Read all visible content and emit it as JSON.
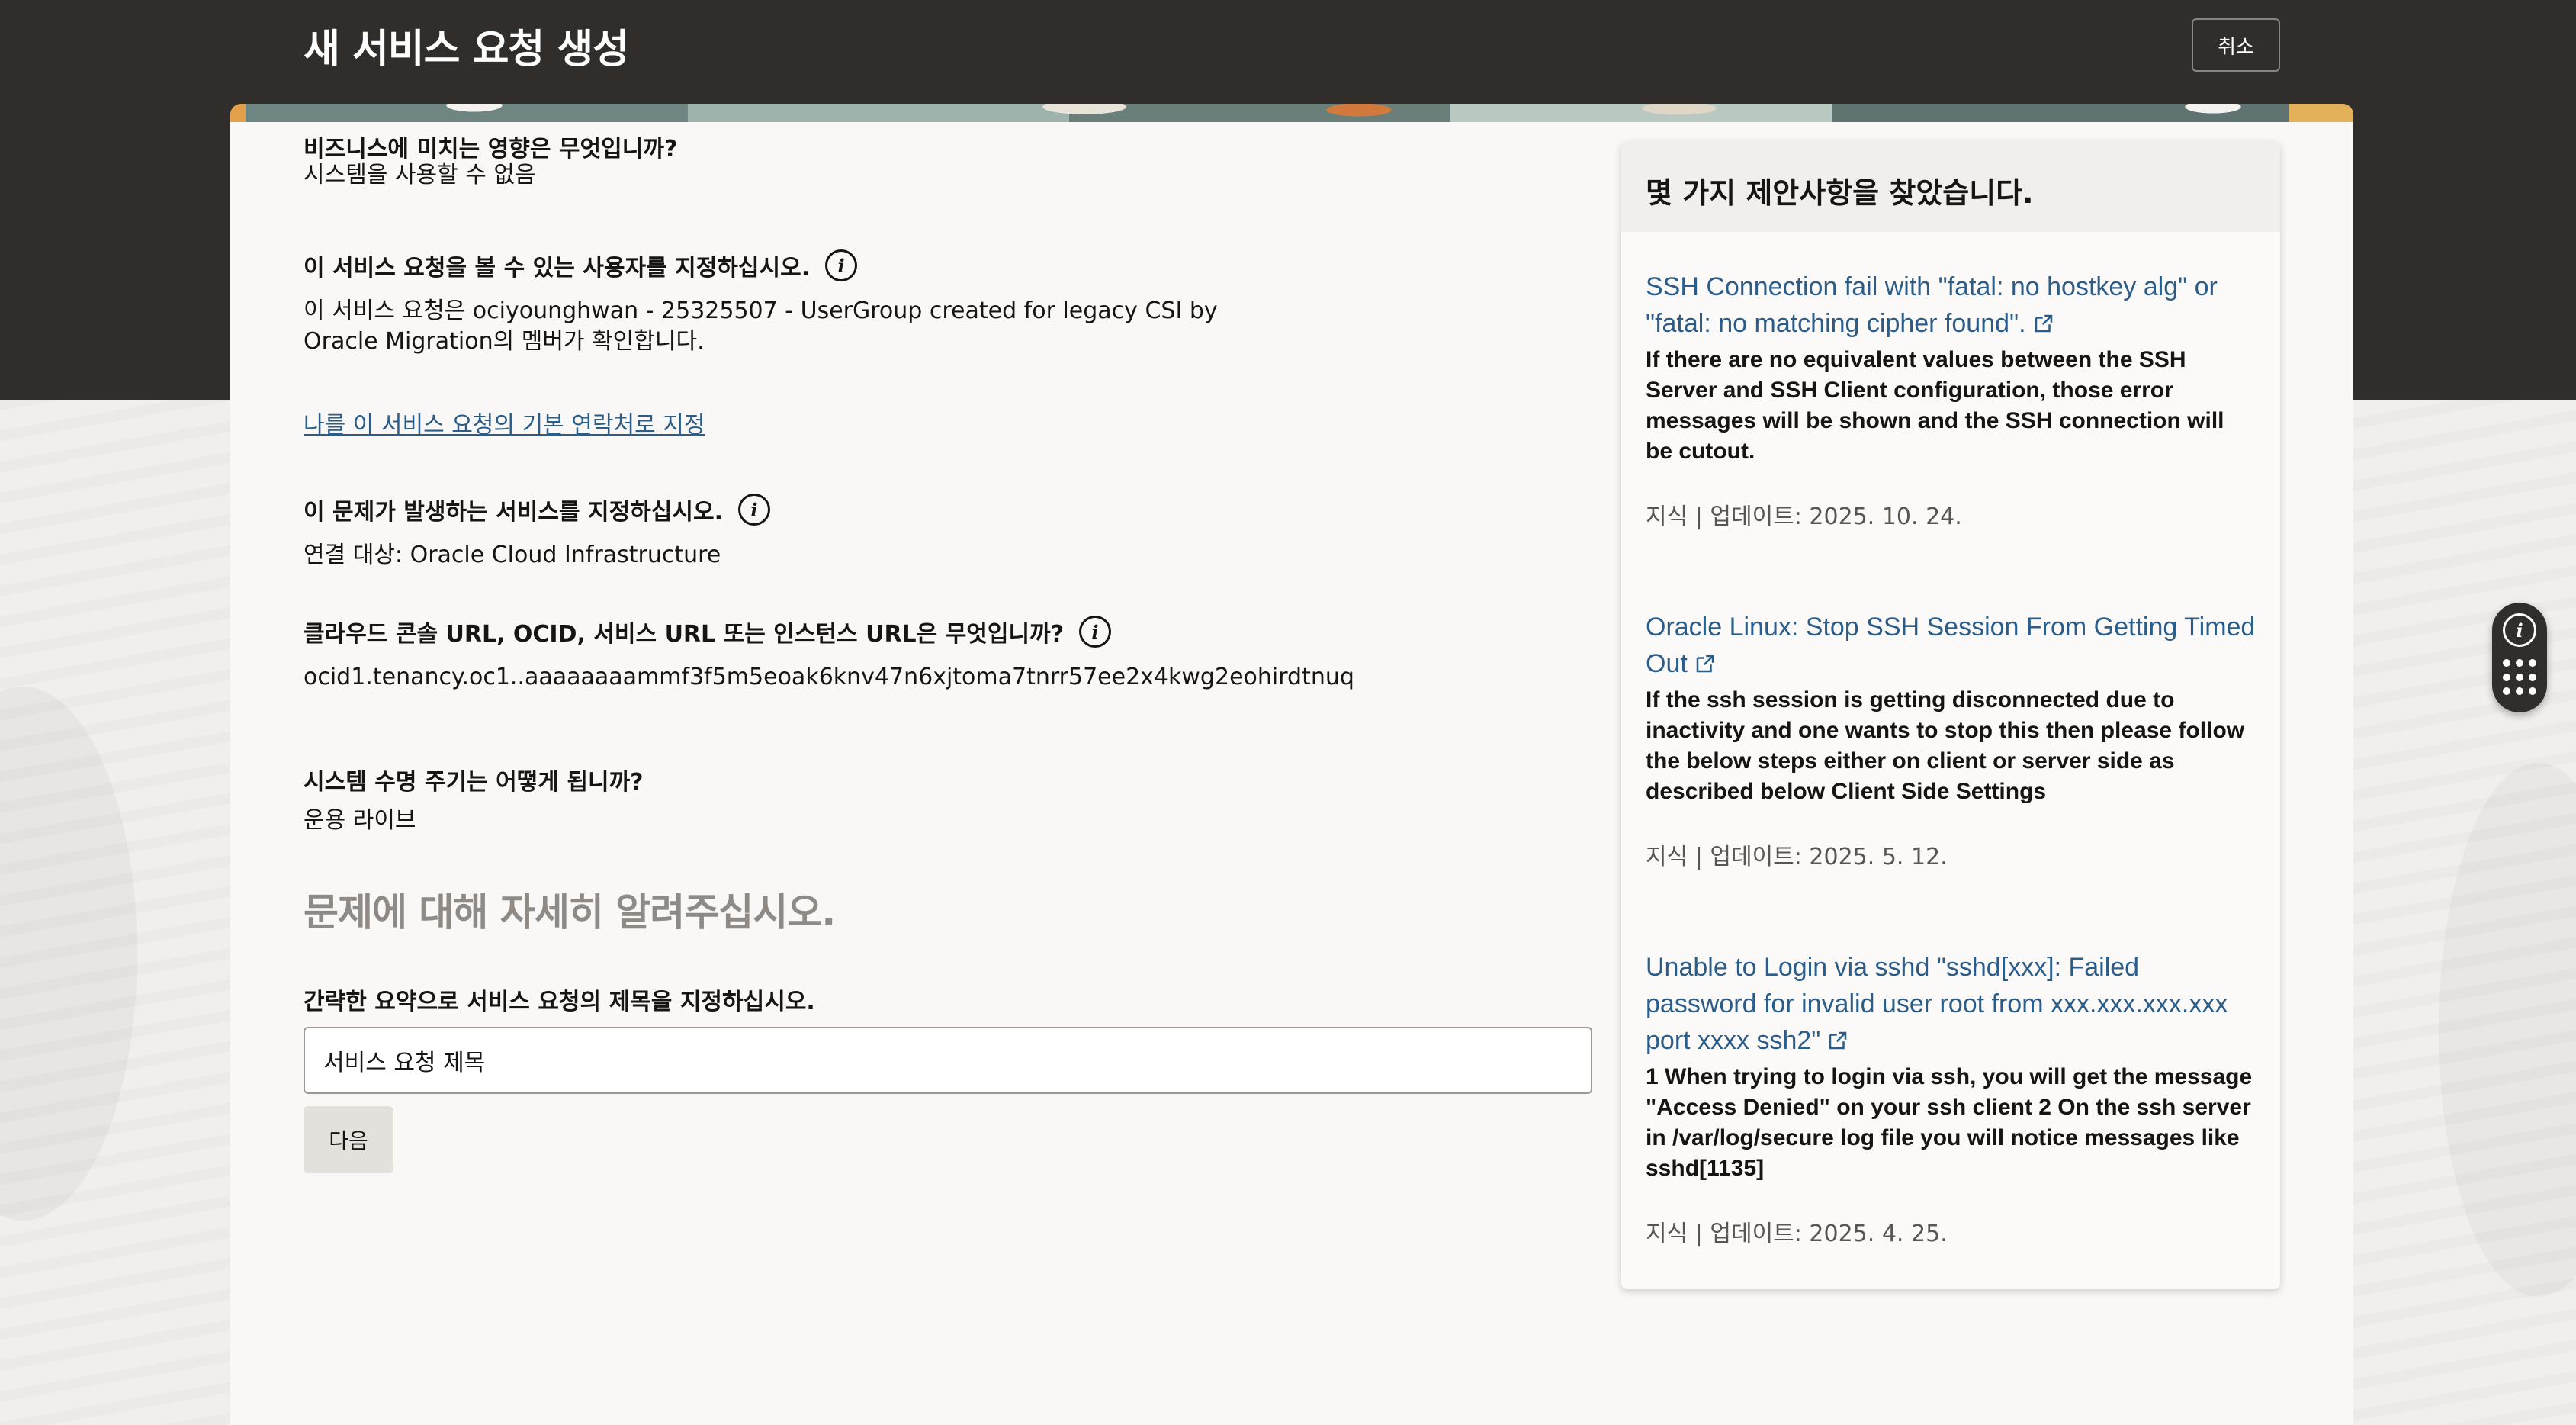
{
  "header": {
    "title": "새 서비스 요청 생성",
    "cancel_label": "취소"
  },
  "form": {
    "impact": {
      "label": "비즈니스에 미치는 영향은 무엇입니까?",
      "value": "시스템을 사용할 수 없음"
    },
    "visibility": {
      "label": "이 서비스 요청을 볼 수 있는 사용자를 지정하십시오.",
      "value_line1": "이 서비스 요청은 ociyounghwan - 25325507 - UserGroup created for legacy CSI by",
      "value_line2": "Oracle Migration의 멤버가 확인합니다."
    },
    "primary_contact_link": "나를 이 서비스 요청의 기본 연락처로 지정",
    "service": {
      "label": "이 문제가 발생하는 서비스를 지정하십시오.",
      "value": "연결 대상: Oracle Cloud Infrastructure"
    },
    "cloud_url": {
      "label": "클라우드 콘솔 URL, OCID, 서비스 URL 또는 인스턴스 URL은 무엇입니까?",
      "value": "ocid1.tenancy.oc1..aaaaaaaammf3f5m5eoak6knv47n6xjtoma7tnrr57ee2x4kwg2eohirdtnuq"
    },
    "lifecycle": {
      "label": "시스템 수명 주기는 어떻게 됩니까?",
      "value": "운용 라이브"
    },
    "details_heading": "문제에 대해 자세히 알려주십시오.",
    "summary": {
      "label": "간략한 요약으로 서비스 요청의 제목을 지정하십시오.",
      "placeholder": "서비스 요청 제목"
    },
    "next_label": "다음"
  },
  "suggestions": {
    "title": "몇 가지 제안사항을 찾았습니다.",
    "items": [
      {
        "title": "SSH Connection fail with \"fatal: no hostkey alg\" or \"fatal: no matching cipher found\".",
        "desc": "If there are no equivalent values between the SSH Server and SSH Client configuration, those error messages will be shown and the SSH connection will be cutout.",
        "meta": "지식 | 업데이트: 2025. 10. 24."
      },
      {
        "title": "Oracle Linux: Stop SSH Session From Getting Timed Out",
        "desc": "If the ssh session is getting disconnected due to inactivity and one wants to stop this then please follow the below steps either on client or server side as described below Client Side Settings",
        "meta": "지식 | 업데이트: 2025. 5. 12."
      },
      {
        "title": "Unable to Login via sshd \"sshd[xxx]: Failed password for invalid user root from xxx.xxx.xxx.xxx port xxxx ssh2\"",
        "desc": "1 When trying to login via ssh, you will get the message \"Access Denied\" on your ssh client 2 On the ssh server in /var/log/secure log file you will notice messages like sshd[1135]",
        "meta": "지식 | 업데이트: 2025. 4. 25."
      }
    ]
  },
  "icons": {
    "info": "info-icon",
    "external": "external-link-icon",
    "grid": "apps-grid-icon"
  },
  "colors": {
    "header_bg": "#312d2a",
    "link": "#2b5d8a",
    "muted_heading": "#8f8a85"
  }
}
